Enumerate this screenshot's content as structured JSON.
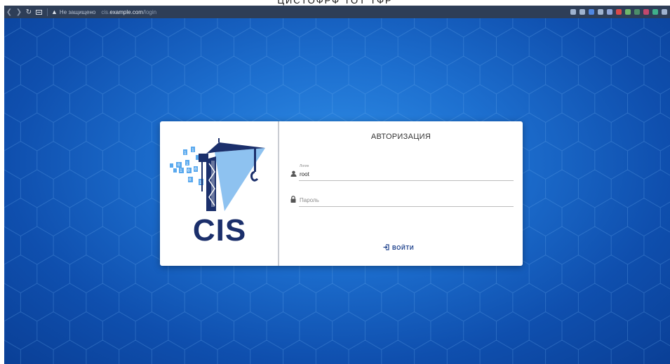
{
  "page_title_partial": "ЦИСТОФРФ ТОТ ТФР",
  "browser": {
    "security_warning": "Не защищено",
    "url_prefix": "cis.",
    "url_host": "example.com",
    "url_path": "/login",
    "extension_colors": [
      "#9fb3cf",
      "#9fb3cf",
      "#4f86e0",
      "#9fb3cf",
      "#8fa6d8",
      "#d94a4a",
      "#6fb86b",
      "#4c8e6a",
      "#c2486d",
      "#3fb08b",
      "#9fb3cf"
    ]
  },
  "login": {
    "title": "АВТОРИЗАЦИЯ",
    "login_field": {
      "label": "Логин",
      "value": "root"
    },
    "password_field": {
      "placeholder": "Пароль"
    },
    "submit_label": "ВОЙТИ"
  },
  "logo": {
    "text": "CIS",
    "brand_color": "#1b2f6b",
    "accent_color": "#8ec2f0"
  }
}
